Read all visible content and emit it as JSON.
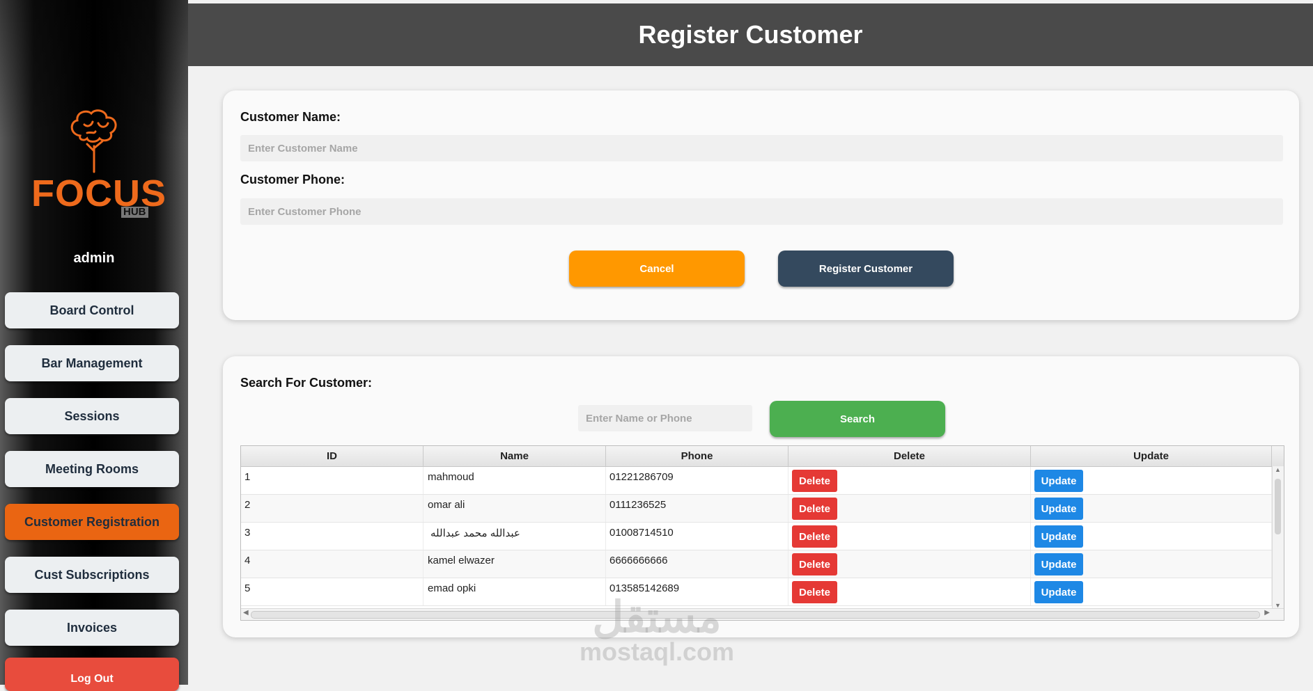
{
  "app": {
    "logo_word": "FOCUS",
    "logo_sub": "HUB",
    "user": "admin"
  },
  "sidebar": {
    "items": [
      {
        "label": "Board Control"
      },
      {
        "label": "Bar Management"
      },
      {
        "label": "Sessions"
      },
      {
        "label": "Meeting Rooms"
      },
      {
        "label": "Customer Registration",
        "active": true
      },
      {
        "label": "Cust Subscriptions"
      },
      {
        "label": "Invoices"
      }
    ],
    "logout": "Log Out"
  },
  "header": {
    "title": "Register Customer"
  },
  "register_form": {
    "name_label": "Customer Name:",
    "name_placeholder": "Enter Customer Name",
    "phone_label": "Customer Phone:",
    "phone_placeholder": "Enter Customer Phone",
    "cancel": "Cancel",
    "register": "Register Customer"
  },
  "search": {
    "label": "Search For Customer:",
    "placeholder": "Enter Name or Phone",
    "button": "Search"
  },
  "table": {
    "columns": [
      "ID",
      "Name",
      "Phone",
      "Delete",
      "Update"
    ],
    "rows": [
      {
        "id": "1",
        "name": "mahmoud",
        "phone": "01221286709",
        "delete": "Delete",
        "update": "Update"
      },
      {
        "id": "2",
        "name": "omar ali",
        "phone": "0111236525",
        "delete": "Delete",
        "update": "Update"
      },
      {
        "id": "3",
        "name": "عبدالله محمد عبدالله",
        "phone": "01008714510",
        "delete": "Delete",
        "update": "Update"
      },
      {
        "id": "4",
        "name": "kamel elwazer",
        "phone": "6666666666",
        "delete": "Delete",
        "update": "Update"
      },
      {
        "id": "5",
        "name": "emad opki",
        "phone": "013585142689",
        "delete": "Delete",
        "update": "Update"
      }
    ]
  },
  "watermark": {
    "arabic": "مستقل",
    "latin": "mostaql.com"
  },
  "colors": {
    "accent_orange": "#ea6512",
    "cancel": "#ff9800",
    "register": "#34495e",
    "search": "#4caf50",
    "delete": "#e53935",
    "update": "#1e88e5",
    "logout": "#e84c3d"
  }
}
